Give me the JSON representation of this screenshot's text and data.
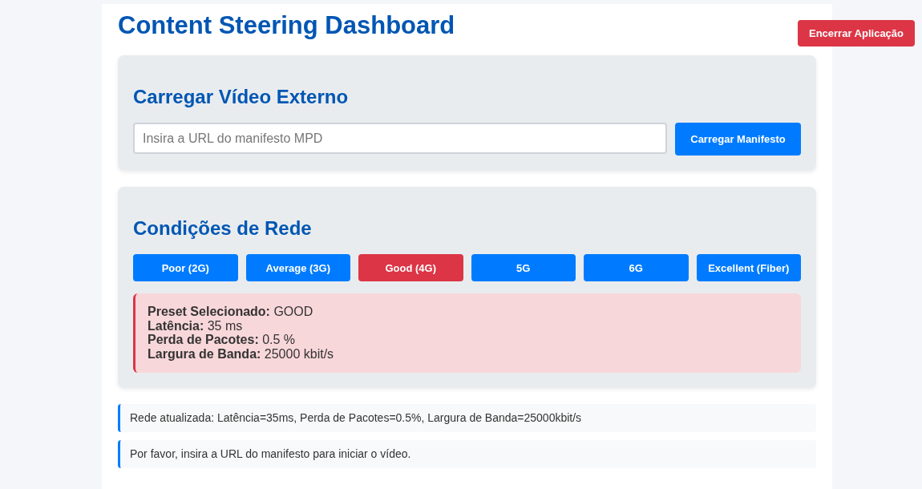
{
  "title": "Content Steering Dashboard",
  "exit_button": "Encerrar Aplicação",
  "video_panel": {
    "heading": "Carregar Vídeo Externo",
    "url_field": {
      "placeholder": "Insira a URL do manifesto MPD"
    },
    "load_button": "Carregar Manifesto"
  },
  "network_panel": {
    "heading": "Condições de Rede",
    "presets": [
      {
        "label": "Poor (2G)",
        "selected": false
      },
      {
        "label": "Average (3G)",
        "selected": false
      },
      {
        "label": "Good (4G)",
        "selected": true
      },
      {
        "label": "5G",
        "selected": false
      },
      {
        "label": "6G",
        "selected": false
      },
      {
        "label": "Excellent (Fiber)",
        "selected": false
      }
    ],
    "info_lines": [
      "**Preset Selecionado:** GOOD",
      "**Latência:** 35 ms",
      "**Perda de Pacotes:** 0.5 %",
      "**Largura de Banda:** 25000 kbit/s"
    ]
  },
  "messages": [
    "Rede atualizada: Latência=35ms, Perda de Pacotes=0.5%, Largura de Banda=25000kbit/s",
    "Por favor, insira a URL do manifesto para iniciar o vídeo."
  ]
}
